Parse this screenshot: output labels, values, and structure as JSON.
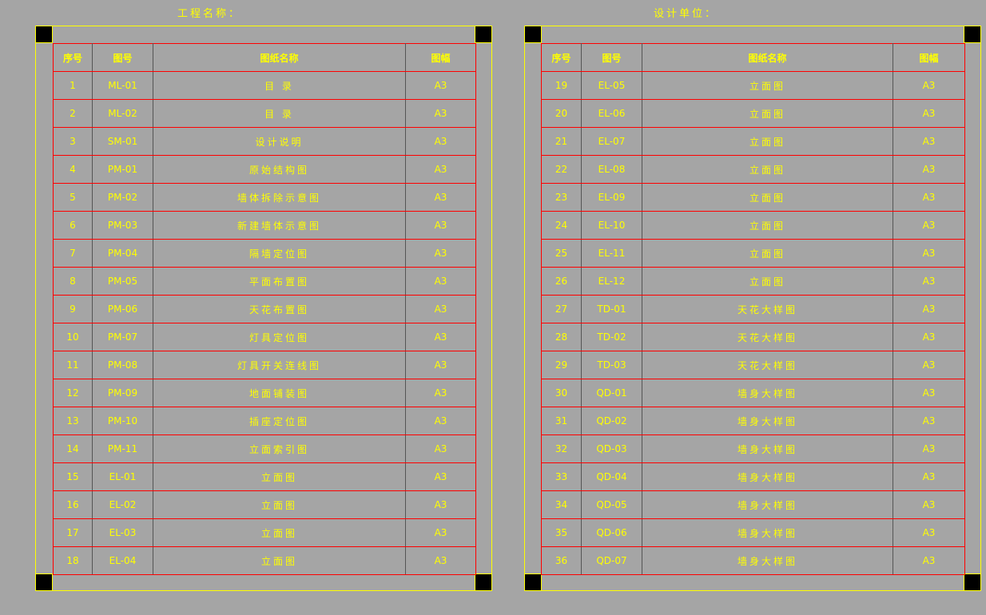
{
  "colors": {
    "background": "#a5a5a5",
    "text": "#ffff00",
    "grid": "#ff0000",
    "frame": "#ffff00"
  },
  "left": {
    "title": "工程名称：",
    "headers": [
      "序号",
      "图号",
      "图纸名称",
      "图幅"
    ],
    "rows": [
      [
        "1",
        "ML-01",
        "目 录",
        "A3"
      ],
      [
        "2",
        "ML-02",
        "目 录",
        "A3"
      ],
      [
        "3",
        "SM-01",
        "设计说明",
        "A3"
      ],
      [
        "4",
        "PM-01",
        "原始结构图",
        "A3"
      ],
      [
        "5",
        "PM-02",
        "墙体拆除示意图",
        "A3"
      ],
      [
        "6",
        "PM-03",
        "新建墙体示意图",
        "A3"
      ],
      [
        "7",
        "PM-04",
        "隔墙定位图",
        "A3"
      ],
      [
        "8",
        "PM-05",
        "平面布置图",
        "A3"
      ],
      [
        "9",
        "PM-06",
        "天花布置图",
        "A3"
      ],
      [
        "10",
        "PM-07",
        "灯具定位图",
        "A3"
      ],
      [
        "11",
        "PM-08",
        "灯具开关连线图",
        "A3"
      ],
      [
        "12",
        "PM-09",
        "地面铺装图",
        "A3"
      ],
      [
        "13",
        "PM-10",
        "插座定位图",
        "A3"
      ],
      [
        "14",
        "PM-11",
        "立面索引图",
        "A3"
      ],
      [
        "15",
        "EL-01",
        "立面图",
        "A3"
      ],
      [
        "16",
        "EL-02",
        "立面图",
        "A3"
      ],
      [
        "17",
        "EL-03",
        "立面图",
        "A3"
      ],
      [
        "18",
        "EL-04",
        "立面图",
        "A3"
      ]
    ]
  },
  "right": {
    "title": "设计单位：",
    "headers": [
      "序号",
      "图号",
      "图纸名称",
      "图幅"
    ],
    "rows": [
      [
        "19",
        "EL-05",
        "立面图",
        "A3"
      ],
      [
        "20",
        "EL-06",
        "立面图",
        "A3"
      ],
      [
        "21",
        "EL-07",
        "立面图",
        "A3"
      ],
      [
        "22",
        "EL-08",
        "立面图",
        "A3"
      ],
      [
        "23",
        "EL-09",
        "立面图",
        "A3"
      ],
      [
        "24",
        "EL-10",
        "立面图",
        "A3"
      ],
      [
        "25",
        "EL-11",
        "立面图",
        "A3"
      ],
      [
        "26",
        "EL-12",
        "立面图",
        "A3"
      ],
      [
        "27",
        "TD-01",
        "天花大样图",
        "A3"
      ],
      [
        "28",
        "TD-02",
        "天花大样图",
        "A3"
      ],
      [
        "29",
        "TD-03",
        "天花大样图",
        "A3"
      ],
      [
        "30",
        "QD-01",
        "墙身大样图",
        "A3"
      ],
      [
        "31",
        "QD-02",
        "墙身大样图",
        "A3"
      ],
      [
        "32",
        "QD-03",
        "墙身大样图",
        "A3"
      ],
      [
        "33",
        "QD-04",
        "墙身大样图",
        "A3"
      ],
      [
        "34",
        "QD-05",
        "墙身大样图",
        "A3"
      ],
      [
        "35",
        "QD-06",
        "墙身大样图",
        "A3"
      ],
      [
        "36",
        "QD-07",
        "墙身大样图",
        "A3"
      ]
    ]
  }
}
